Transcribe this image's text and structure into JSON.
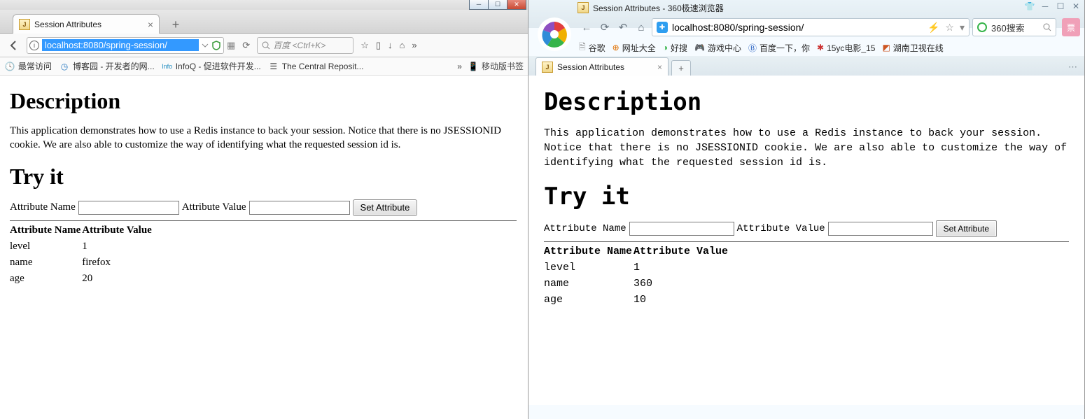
{
  "firefox": {
    "tabTitle": "Session Attributes",
    "url": "localhost:8080/spring-session/",
    "searchPlaceholder": "百度 <Ctrl+K>",
    "bookmarks": {
      "b1": "最常访问",
      "b2": "博客园 - 开发者的网...",
      "b3": "InfoQ - 促进软件开发...",
      "b4": "The Central Reposit...",
      "moreChevron": "»",
      "mobile": "移动版书签"
    }
  },
  "browser360": {
    "windowTitle": "Session Attributes - 360极速浏览器",
    "url": "localhost:8080/spring-session/",
    "searchPlaceholder": "360搜索",
    "tabTitle": "Session Attributes",
    "bookmarks": {
      "b1": "谷歌",
      "b2": "网址大全",
      "b3": "好搜",
      "b4": "游戏中心",
      "b5": "百度一下，你",
      "b6": "15yc电影_15",
      "b7": "湖南卫视在线"
    }
  },
  "page": {
    "h1": "Description",
    "para": "This application demonstrates how to use a Redis instance to back your session. Notice that there is no JSESSIONID cookie. We are also able to customize the way of identifying what the requested session id is.",
    "h2": "Try it",
    "labelName": "Attribute Name",
    "labelValue": "Attribute Value",
    "btn": "Set Attribute",
    "col1": "Attribute Name",
    "col2": "Attribute Value"
  },
  "rowsFirefox": [
    {
      "k": "level",
      "v": "1"
    },
    {
      "k": "name",
      "v": "firefox"
    },
    {
      "k": "age",
      "v": "20"
    }
  ],
  "rows360": [
    {
      "k": "level",
      "v": "1"
    },
    {
      "k": "name",
      "v": "360"
    },
    {
      "k": "age",
      "v": "10"
    }
  ]
}
